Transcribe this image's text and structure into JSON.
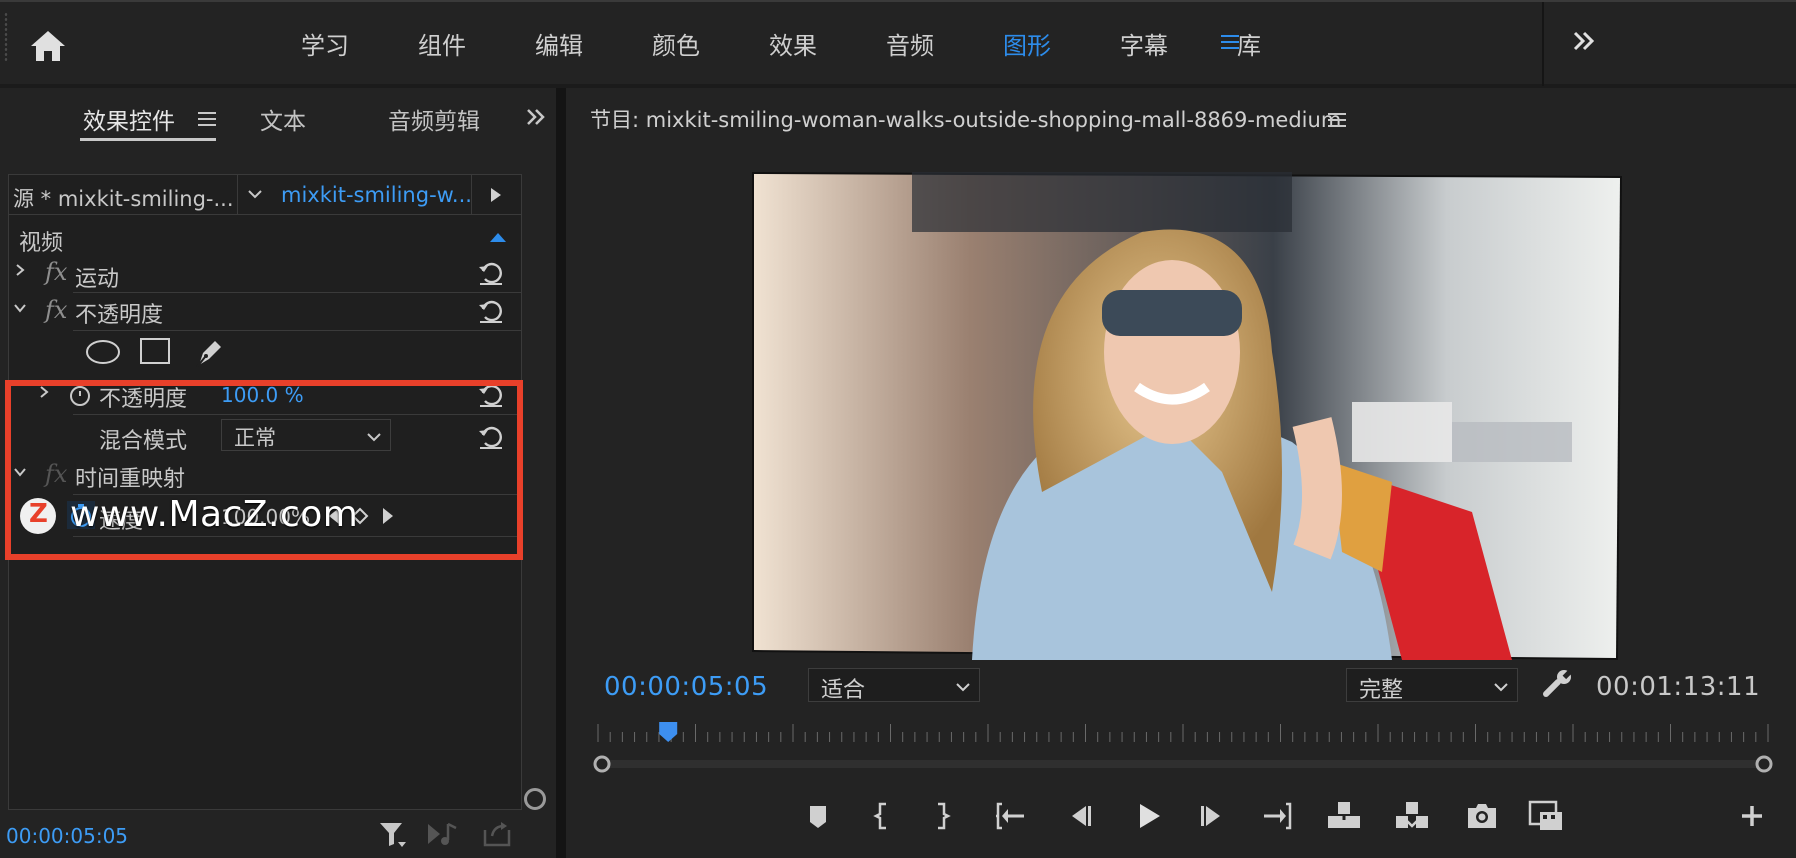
{
  "topbar": {
    "home_icon": "home-icon",
    "tabs": [
      {
        "label": "学习",
        "active": false
      },
      {
        "label": "组件",
        "active": false
      },
      {
        "label": "编辑",
        "active": false
      },
      {
        "label": "颜色",
        "active": false
      },
      {
        "label": "效果",
        "active": false
      },
      {
        "label": "音频",
        "active": false
      },
      {
        "label": "图形",
        "active": true
      },
      {
        "label": "字幕",
        "active": false
      },
      {
        "label": "库",
        "active": false
      }
    ],
    "accent_color": "#2d8ceb"
  },
  "left_panel": {
    "tabs": {
      "effects": "效果控件",
      "text": "文本",
      "audio": "音频剪辑"
    },
    "source_label": "源 * mixkit-smiling-...",
    "clip_label": "mixkit-smiling-w...",
    "section_video": "视频",
    "effects": {
      "motion": "运动",
      "opacity": "不透明度",
      "opacity_param": "不透明度",
      "opacity_value": "100.0 %",
      "blend_mode_label": "混合模式",
      "blend_mode_value": "正常",
      "time_remap": "时间重映射",
      "speed_label": "速度",
      "speed_value": "100.00%"
    },
    "fx_symbol": "fx",
    "timecode": "00:00:05:05",
    "highlight_color": "#e8402a"
  },
  "watermark": {
    "logo_letter": "Z",
    "text": "www.MacZ.com"
  },
  "program_monitor": {
    "title": "节目: mixkit-smiling-woman-walks-outside-shopping-mall-8869-medium",
    "timecode_current": "00:00:05:05",
    "fit_value": "适合",
    "quality_value": "完整",
    "timecode_duration": "00:01:13:11",
    "playhead_position": 0.06
  },
  "colors": {
    "panel_bg": "#232323",
    "accent_blue": "#3d9cf5"
  }
}
